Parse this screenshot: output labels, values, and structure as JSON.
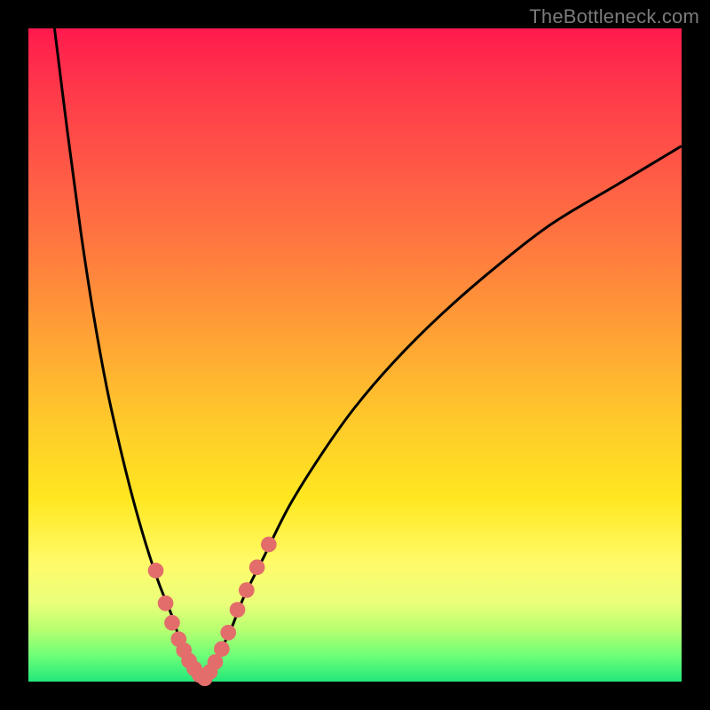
{
  "watermark": "TheBottleneck.com",
  "chart_data": {
    "type": "line",
    "title": "",
    "xlabel": "",
    "ylabel": "",
    "xlim": [
      0,
      100
    ],
    "ylim": [
      0,
      100
    ],
    "grid": false,
    "legend": false,
    "series": [
      {
        "name": "left-curve",
        "x": [
          4,
          6,
          8,
          10,
          12,
          14,
          16,
          18,
          20,
          22,
          23,
          24,
          25,
          26,
          27
        ],
        "values": [
          100,
          84,
          69,
          56,
          45,
          36,
          28,
          21,
          15,
          10,
          7,
          5,
          3,
          1.5,
          0.5
        ]
      },
      {
        "name": "right-curve",
        "x": [
          27,
          29,
          31,
          33,
          36,
          40,
          45,
          50,
          56,
          63,
          71,
          80,
          90,
          100
        ],
        "values": [
          0.5,
          4,
          8,
          13,
          19,
          27,
          35,
          42,
          49,
          56,
          63,
          70,
          76,
          82
        ]
      }
    ],
    "markers": {
      "name": "dots",
      "color": "#e36d6a",
      "radius": 1.2,
      "x": [
        19.5,
        21,
        22,
        23,
        23.8,
        24.6,
        25.4,
        26.2,
        27,
        27.8,
        28.6,
        29.6,
        30.6,
        32,
        33.4,
        35,
        36.8
      ],
      "values": [
        17,
        12,
        9,
        6.5,
        4.8,
        3.2,
        2.0,
        1.0,
        0.5,
        1.5,
        3.0,
        5.0,
        7.5,
        11,
        14,
        17.5,
        21
      ]
    }
  }
}
